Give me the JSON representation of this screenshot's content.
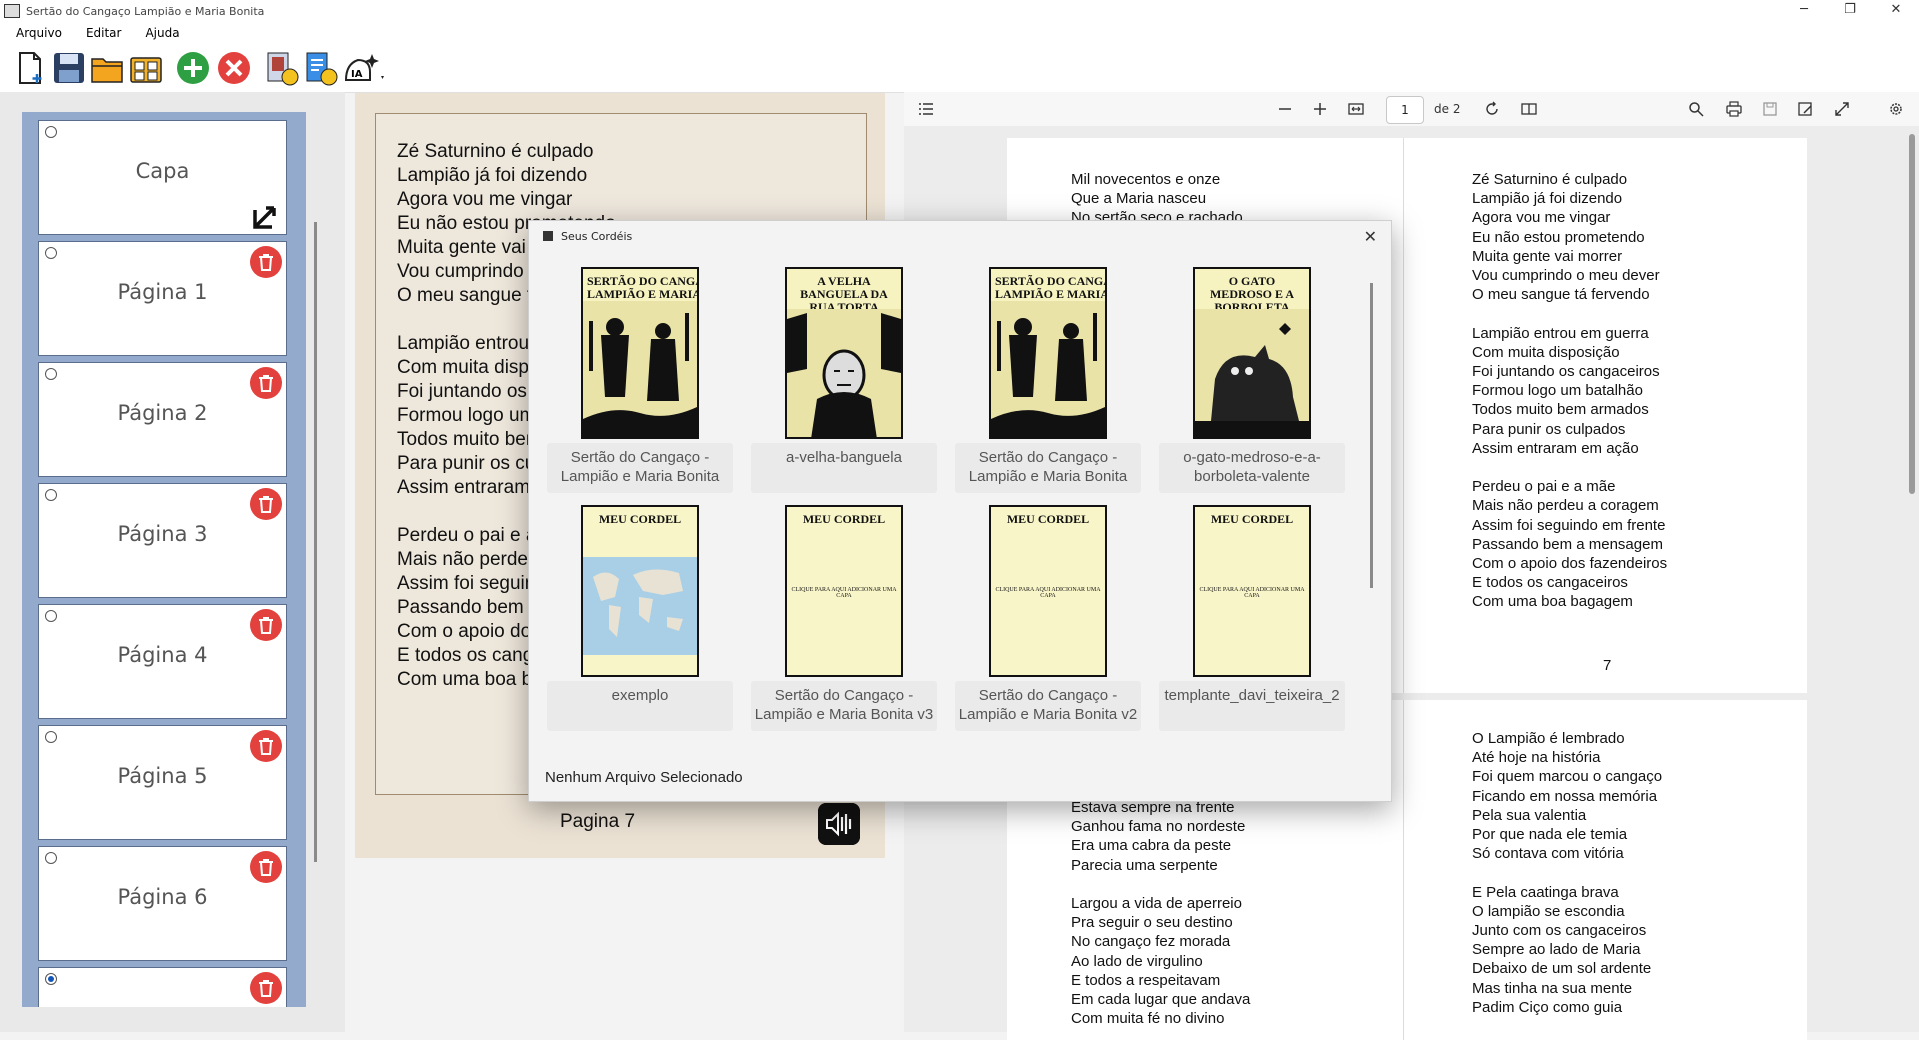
{
  "window": {
    "title": "Sertão do Cangaço  Lampião e Maria Bonita"
  },
  "menu": [
    "Arquivo",
    "Editar",
    "Ajuda"
  ],
  "toolbar": {
    "icons": [
      "new-document-icon",
      "save-icon",
      "open-folder-icon",
      "library-icon",
      "add-page-icon",
      "remove-page-icon",
      "export-pdf-icon",
      "export-doc-icon",
      "ai-assist-icon"
    ]
  },
  "sidebar": {
    "items": [
      {
        "label": "Capa",
        "selected": false
      },
      {
        "label": "Página 1",
        "selected": false
      },
      {
        "label": "Página 2",
        "selected": false
      },
      {
        "label": "Página 3",
        "selected": false
      },
      {
        "label": "Página 4",
        "selected": false
      },
      {
        "label": "Página 5",
        "selected": false
      },
      {
        "label": "Página 6",
        "selected": false
      },
      {
        "label": "",
        "selected": true
      }
    ]
  },
  "editor": {
    "text": "Zé Saturnino é culpado\nLampião já foi dizendo\nAgora vou me vingar\nEu não estou prometendo\nMuita gente vai mo\nVou cumprindo o\nO meu sangue tá f\n\nLampião entrou er\nCom muita dispos\nFoi juntando os ca\nFormou logo um b\nTodos muito bem\nPara punir os culp\nAssim entraram er\n\nPerdeu o pai e a n\nMais não perdeu a\nAssim foi seguindo\nPassando bem a n\nCom o apoio dos f\nE todos os cangac\nCom uma boa bag",
    "page_label": "Pagina 7"
  },
  "pdf": {
    "page_input": "1",
    "page_of": "de 2",
    "page1": {
      "left": "Mil novecentos e onze\nQue a Maria nasceu\nNo sertão seco e rachado",
      "right": "Zé Saturnino é culpado\nLampião já foi dizendo\nAgora vou me vingar\nEu não estou prometendo\nMuita gente vai morrer\nVou cumprindo o meu dever\nO meu sangue tá fervendo\n\nLampião entrou em guerra\nCom muita disposição\nFoi juntando os cangaceiros\nFormou logo um batalhão\nTodos muito bem armados\nPara punir os culpados\nAssim entraram em ação\n\nPerdeu o pai e a mãe\nMais não perdeu a coragem\nAssim foi seguindo em frente\nPassando bem a mensagem\nCom o apoio dos fazendeiros\nE todos os cangaceiros\nCom uma boa bagagem",
      "page_number": "7"
    },
    "page2": {
      "left": "Estava sempre na frente\nGanhou fama no nordeste\nEra uma cabra da peste\nParecia uma serpente\n\nLargou a vida de aperreio\nPra seguir o seu destino\nNo cangaço fez morada\nAo lado de virgulino\nE todos a respeitavam\nEm cada lugar que andava\nCom muita fé no divino",
      "right": "O Lampião é lembrado\nAté hoje na história\nFoi quem marcou o cangaço\nFicando em nossa memória\nPela sua valentia\nPor que nada ele temia\nSó contava com vitória\n\nE Pela caatinga brava\nO lampião se escondia\nJunto com os cangaceiros\nSempre ao lado de Maria\nDebaixo de um sol ardente\nMas tinha na sua mente\nPadim Ciço como guia"
    }
  },
  "dialog": {
    "title": "Seus Cordéis",
    "status": "Nenhum Arquivo Selecionado",
    "items": [
      {
        "label": "Sertão do Cangaço - Lampião e Maria Bonita",
        "cover_title": "SERTÃO DO CANGAÇO\nLAMPIÃO E MARIA BONITA",
        "style": "woodcut"
      },
      {
        "label": "a-velha-banguela",
        "cover_title": "A VELHA BANGUELA DA RUA TORTA",
        "style": "woodcut"
      },
      {
        "label": "Sertão do Cangaço - Lampião e Maria Bonita",
        "cover_title": "SERTÃO DO CANGAÇO\nLAMPIÃO E MARIA BONITA",
        "style": "woodcut"
      },
      {
        "label": "o-gato-medroso-e-a-borboleta-valente",
        "cover_title": "O GATO MEDROSO E A BORBOLETA VALENTE",
        "style": "woodcut"
      },
      {
        "label": "exemplo",
        "cover_title": "MEU CORDEL",
        "style": "map"
      },
      {
        "label": "Sertão do Cangaço - Lampião e Maria Bonita v3",
        "cover_title": "MEU CORDEL",
        "cover_center": "CLIQUE PARA AQUI ADICIONAR UMA CAPA",
        "style": "blank"
      },
      {
        "label": "Sertão do Cangaço - Lampião e Maria Bonita v2",
        "cover_title": "MEU CORDEL",
        "cover_center": "CLIQUE PARA AQUI ADICIONAR UMA CAPA",
        "style": "blank"
      },
      {
        "label": "templante_davi_teixeira_2",
        "cover_title": "MEU CORDEL",
        "cover_center": "CLIQUE PARA AQUI ADICIONAR UMA CAPA",
        "style": "blank"
      }
    ]
  },
  "colors": {
    "sidebar_bg": "#93aacd",
    "delete": "#e2413d",
    "editor_bg": "#ebe2d4",
    "cover_bg": "#f8f5c8"
  }
}
